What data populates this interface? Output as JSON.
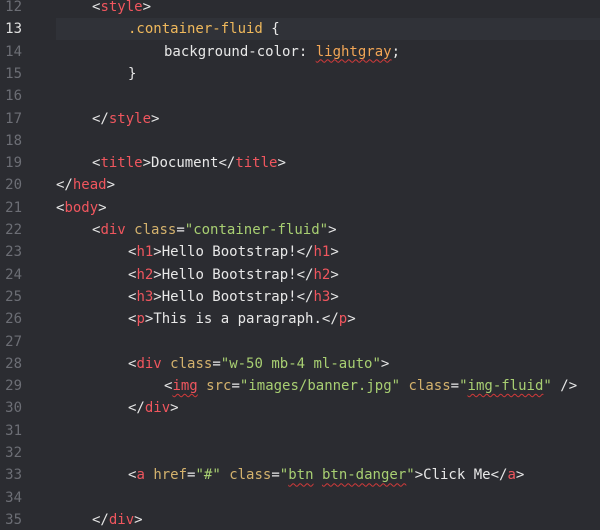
{
  "editor": {
    "active_line": 13,
    "lines": [
      {
        "n": "12",
        "indent": 1,
        "tokens": [
          [
            "tag-open",
            "<"
          ],
          [
            "tag",
            "style"
          ],
          [
            "tag-close",
            ">"
          ]
        ]
      },
      {
        "n": "13",
        "indent": 2,
        "tokens": [
          [
            "sel",
            ".container-fluid"
          ],
          [
            "txt",
            " {"
          ]
        ]
      },
      {
        "n": "14",
        "indent": 3,
        "tokens": [
          [
            "prop",
            "background-color"
          ],
          [
            "txt",
            ": "
          ],
          [
            "valsq",
            "lightgray"
          ],
          [
            "txt",
            ";"
          ]
        ]
      },
      {
        "n": "15",
        "indent": 2,
        "tokens": [
          [
            "txt",
            "}"
          ]
        ]
      },
      {
        "n": "16",
        "indent": 0,
        "tokens": []
      },
      {
        "n": "17",
        "indent": 1,
        "tokens": [
          [
            "tag-open",
            "</"
          ],
          [
            "tag",
            "style"
          ],
          [
            "tag-close",
            ">"
          ]
        ]
      },
      {
        "n": "18",
        "indent": 0,
        "tokens": []
      },
      {
        "n": "19",
        "indent": 1,
        "tokens": [
          [
            "tag-open",
            "<"
          ],
          [
            "tag",
            "title"
          ],
          [
            "tag-close",
            ">"
          ],
          [
            "txt",
            "Document"
          ],
          [
            "tag-open",
            "</"
          ],
          [
            "tag",
            "title"
          ],
          [
            "tag-close",
            ">"
          ]
        ]
      },
      {
        "n": "20",
        "indent": 0,
        "tokens": [
          [
            "tag-open",
            "</"
          ],
          [
            "tag",
            "head"
          ],
          [
            "tag-close",
            ">"
          ]
        ]
      },
      {
        "n": "21",
        "indent": 0,
        "tokens": [
          [
            "tag-open",
            "<"
          ],
          [
            "tag",
            "body"
          ],
          [
            "tag-close",
            ">"
          ]
        ]
      },
      {
        "n": "22",
        "indent": 1,
        "tokens": [
          [
            "tag-open",
            "<"
          ],
          [
            "tag",
            "div"
          ],
          [
            "txt",
            " "
          ],
          [
            "attr",
            "class"
          ],
          [
            "txt",
            "="
          ],
          [
            "str",
            "\"container-fluid\""
          ],
          [
            "tag-close",
            ">"
          ]
        ]
      },
      {
        "n": "23",
        "indent": 2,
        "tokens": [
          [
            "tag-open",
            "<"
          ],
          [
            "tag",
            "h1"
          ],
          [
            "tag-close",
            ">"
          ],
          [
            "txt",
            "Hello Bootstrap!"
          ],
          [
            "tag-open",
            "</"
          ],
          [
            "tag",
            "h1"
          ],
          [
            "tag-close",
            ">"
          ]
        ]
      },
      {
        "n": "24",
        "indent": 2,
        "tokens": [
          [
            "tag-open",
            "<"
          ],
          [
            "tag",
            "h2"
          ],
          [
            "tag-close",
            ">"
          ],
          [
            "txt",
            "Hello Bootstrap!"
          ],
          [
            "tag-open",
            "</"
          ],
          [
            "tag",
            "h2"
          ],
          [
            "tag-close",
            ">"
          ]
        ]
      },
      {
        "n": "25",
        "indent": 2,
        "tokens": [
          [
            "tag-open",
            "<"
          ],
          [
            "tag",
            "h3"
          ],
          [
            "tag-close",
            ">"
          ],
          [
            "txt",
            "Hello Bootstrap!"
          ],
          [
            "tag-open",
            "</"
          ],
          [
            "tag",
            "h3"
          ],
          [
            "tag-close",
            ">"
          ]
        ]
      },
      {
        "n": "26",
        "indent": 2,
        "tokens": [
          [
            "tag-open",
            "<"
          ],
          [
            "tag",
            "p"
          ],
          [
            "tag-close",
            ">"
          ],
          [
            "txt",
            "This is a paragraph."
          ],
          [
            "tag-open",
            "</"
          ],
          [
            "tag",
            "p"
          ],
          [
            "tag-close",
            ">"
          ]
        ]
      },
      {
        "n": "27",
        "indent": 0,
        "tokens": []
      },
      {
        "n": "28",
        "indent": 2,
        "tokens": [
          [
            "tag-open",
            "<"
          ],
          [
            "tag",
            "div"
          ],
          [
            "txt",
            " "
          ],
          [
            "attr",
            "class"
          ],
          [
            "txt",
            "="
          ],
          [
            "str",
            "\"w-50 mb-4 ml-auto\""
          ],
          [
            "tag-close",
            ">"
          ]
        ]
      },
      {
        "n": "29",
        "indent": 3,
        "tokens": [
          [
            "tag-open",
            "<"
          ],
          [
            "tagsq",
            "img"
          ],
          [
            "txt",
            " "
          ],
          [
            "attr",
            "src"
          ],
          [
            "txt",
            "="
          ],
          [
            "str",
            "\"images/banner.jpg\""
          ],
          [
            "txt",
            " "
          ],
          [
            "attr",
            "class"
          ],
          [
            "txt",
            "="
          ],
          [
            "str",
            "\""
          ],
          [
            "strsq",
            "img-fluid"
          ],
          [
            "str",
            "\""
          ],
          [
            "txt",
            " "
          ],
          [
            "tag-close",
            "/>"
          ]
        ]
      },
      {
        "n": "30",
        "indent": 2,
        "tokens": [
          [
            "tag-open",
            "</"
          ],
          [
            "tag",
            "div"
          ],
          [
            "tag-close",
            ">"
          ]
        ]
      },
      {
        "n": "31",
        "indent": 0,
        "tokens": []
      },
      {
        "n": "32",
        "indent": 0,
        "tokens": []
      },
      {
        "n": "33",
        "indent": 2,
        "tokens": [
          [
            "tag-open",
            "<"
          ],
          [
            "tag",
            "a"
          ],
          [
            "txt",
            " "
          ],
          [
            "attr",
            "href"
          ],
          [
            "txt",
            "="
          ],
          [
            "str",
            "\"#\""
          ],
          [
            "txt",
            " "
          ],
          [
            "attr",
            "class"
          ],
          [
            "txt",
            "="
          ],
          [
            "str",
            "\""
          ],
          [
            "strsq",
            "btn"
          ],
          [
            "str",
            " "
          ],
          [
            "strsq",
            "btn-danger"
          ],
          [
            "str",
            "\""
          ],
          [
            "tag-close",
            ">"
          ],
          [
            "txt",
            "Click Me"
          ],
          [
            "tag-open",
            "</"
          ],
          [
            "tag",
            "a"
          ],
          [
            "tag-close",
            ">"
          ]
        ]
      },
      {
        "n": "34",
        "indent": 0,
        "tokens": []
      },
      {
        "n": "35",
        "indent": 1,
        "tokens": [
          [
            "tag-open",
            "</"
          ],
          [
            "tag",
            "div"
          ],
          [
            "tag-close",
            ">"
          ]
        ]
      }
    ]
  }
}
